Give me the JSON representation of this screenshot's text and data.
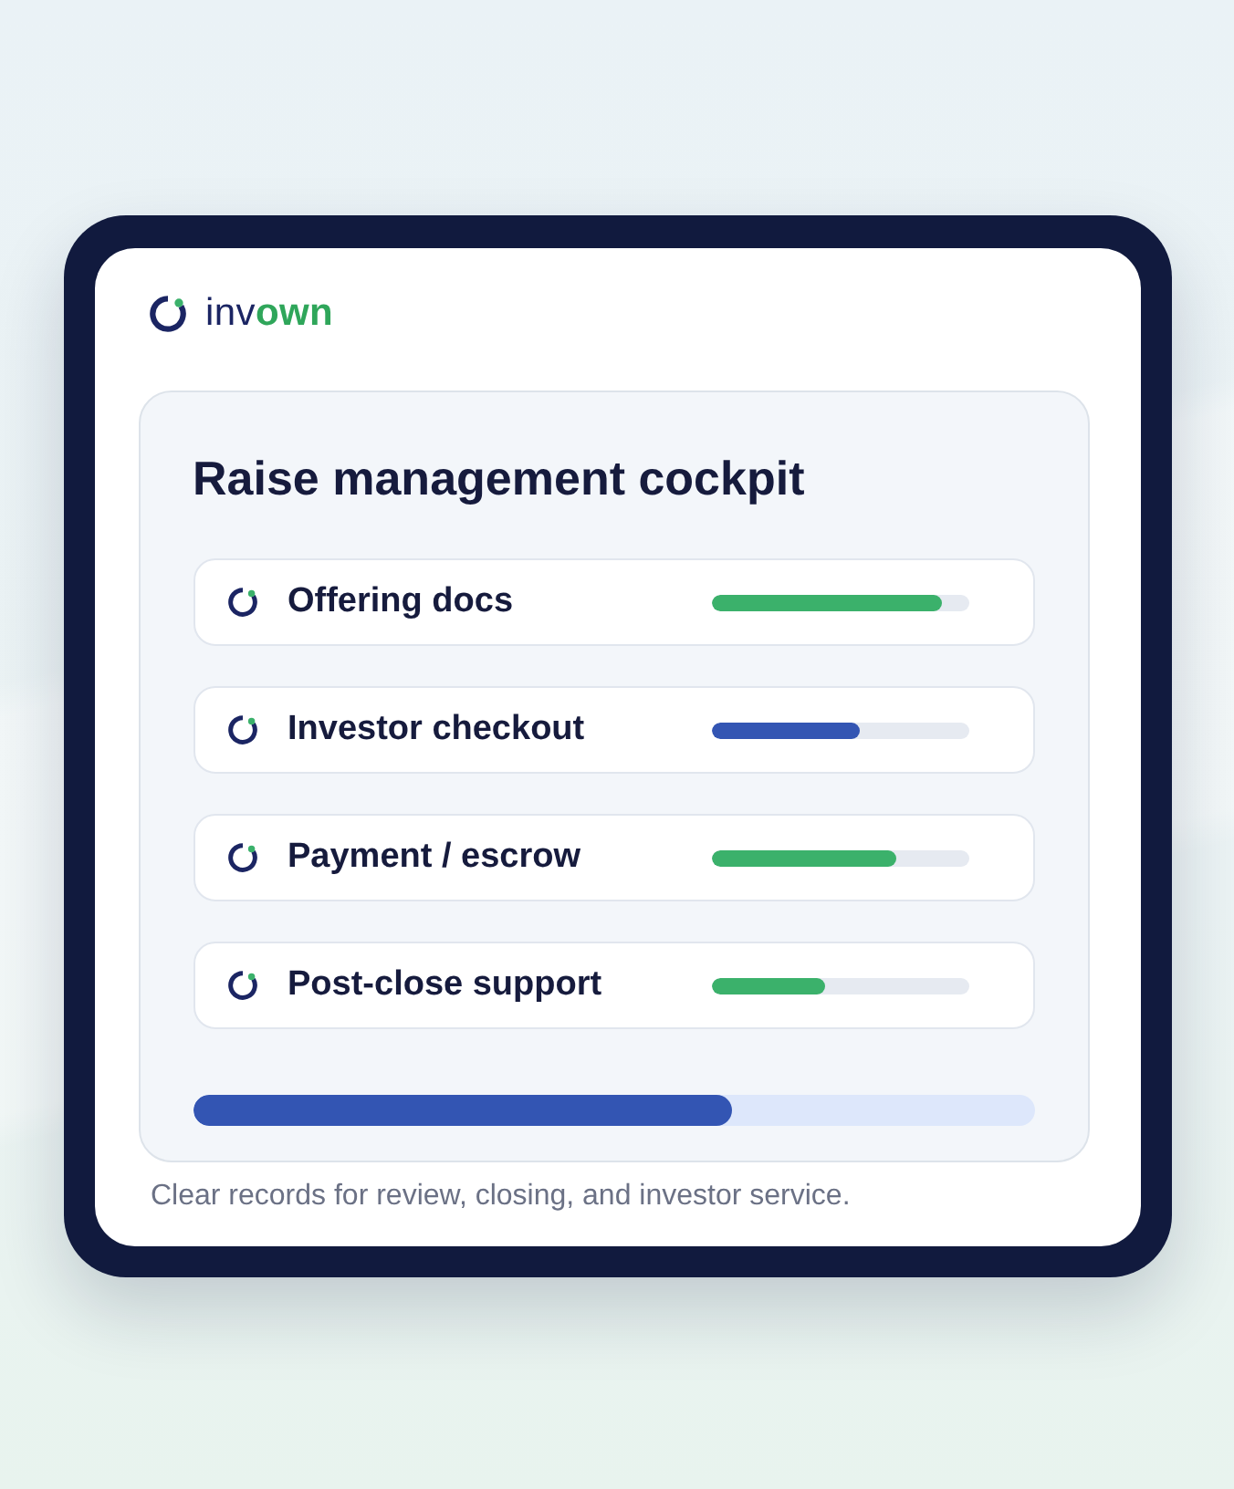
{
  "logo": {
    "wordmark": "inv**own**"
  },
  "panel": {
    "title": "Raise management cockpit",
    "items": [
      {
        "label": "Offering docs",
        "level": 0.9,
        "color": "#3bb16b"
      },
      {
        "label": "Investor checkout",
        "level": 0.58,
        "color": "#3355b3"
      },
      {
        "label": "Payment / escrow",
        "level": 0.72,
        "color": "#3bb16b"
      },
      {
        "label": "Post-close support",
        "level": 0.44,
        "color": "#3bb16b"
      }
    ],
    "overall": {
      "level": 0.64
    }
  },
  "caption": "Clear records for review, closing, and investor service."
}
